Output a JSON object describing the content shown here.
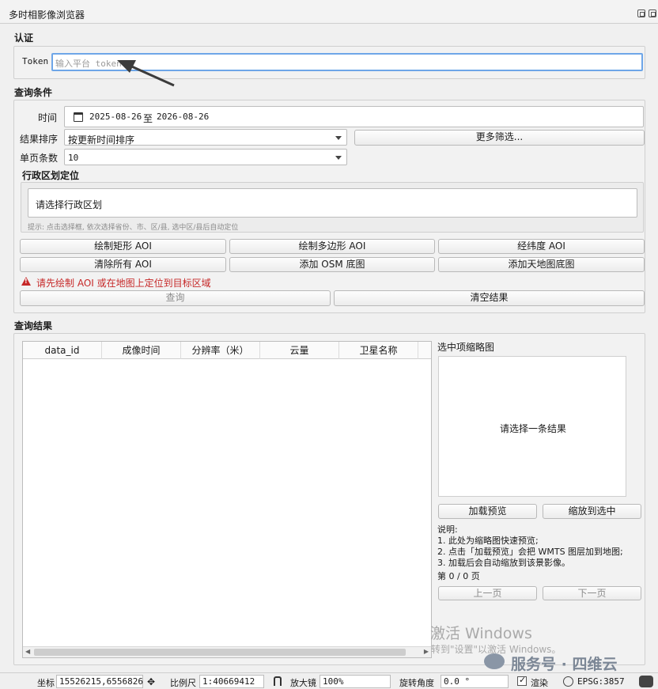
{
  "window": {
    "title": "多时相影像浏览器"
  },
  "auth": {
    "title": "认证",
    "token_label": "Token",
    "token_placeholder": "输入平台 token"
  },
  "query": {
    "title": "查询条件",
    "time_label": "时间",
    "date_from": "2025-08-26",
    "date_sep": "至",
    "date_to": "2026-08-26",
    "sort_label": "结果排序",
    "sort_value": "按更新时间排序",
    "more_filter": "更多筛选...",
    "page_size_label": "单页条数",
    "page_size_value": "10"
  },
  "region": {
    "title": "行政区划定位",
    "placeholder": "请选择行政区划",
    "hint": "提示: 点击选择框, 依次选择省份、市、区/县, 选中区/县后自动定位"
  },
  "actions": {
    "draw_rect": "绘制矩形 AOI",
    "draw_polygon": "绘制多边形 AOI",
    "lonlat": "经纬度 AOI",
    "clear_all": "清除所有 AOI",
    "add_osm": "添加 OSM 底图",
    "add_tianditu": "添加天地图底图",
    "warning": "请先绘制 AOI 或在地图上定位到目标区域",
    "query": "查询",
    "clear_results": "清空结果"
  },
  "results": {
    "title": "查询结果",
    "columns": [
      "data_id",
      "成像时间",
      "分辨率（米）",
      "云量",
      "卫星名称"
    ]
  },
  "preview": {
    "title": "选中项缩略图",
    "empty": "请选择一条结果",
    "load_preview": "加载预览",
    "zoom_to": "缩放到选中",
    "desc_title": "说明:",
    "desc_lines": [
      "1. 此处为缩略图快速预览;",
      "2. 点击「加载预览」会把 WMTS 图层加到地图;",
      "3. 加载后会自动缩放到该景影像。"
    ],
    "page_info": "第 0 / 0 页",
    "prev": "上一页",
    "next": "下一页"
  },
  "watermark": {
    "activate": "激活 Windows",
    "activate_sub": "转到\"设置\"以激活 Windows。",
    "brand": "服务号 · 四维云"
  },
  "statusbar": {
    "coord_label": "坐标",
    "coord_value": "15526215,6556826",
    "scale_label": "比例尺",
    "scale_value": "1:40669412",
    "magnifier_label": "放大镜",
    "magnifier_value": "100%",
    "rotation_label": "旋转角度",
    "rotation_value": "0.0 °",
    "render_label": "渲染",
    "crs": "EPSG:3857"
  },
  "colors": {
    "warning": "#c62828",
    "focus": "#6ea6e8"
  }
}
